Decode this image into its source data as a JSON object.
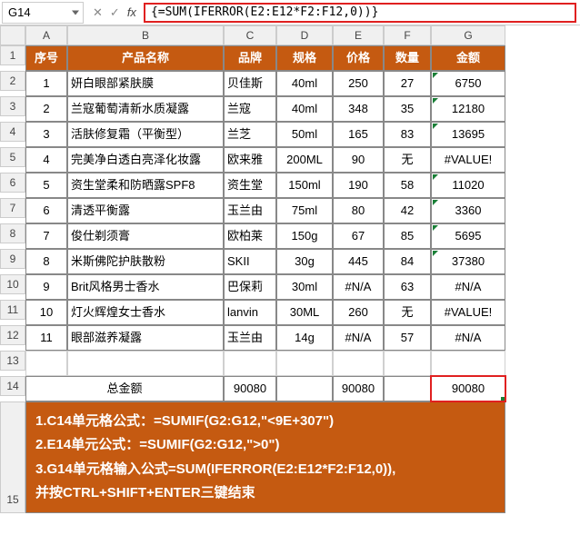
{
  "formula_bar": {
    "cell_ref": "G14",
    "formula": "{=SUM(IFERROR(E2:E12*F2:F12,0))}"
  },
  "columns": [
    "A",
    "B",
    "C",
    "D",
    "E",
    "F",
    "G"
  ],
  "header": {
    "a": "序号",
    "b": "产品名称",
    "c": "品牌",
    "d": "规格",
    "e": "价格",
    "f": "数量",
    "g": "金额"
  },
  "rows": [
    {
      "n": "1",
      "seq": "1",
      "name": "妍白眼部紧肤膜",
      "brand": "贝佳斯",
      "spec": "40ml",
      "price": "250",
      "qty": "27",
      "amt": "6750"
    },
    {
      "n": "2",
      "seq": "2",
      "name": "兰寇葡萄清新水质凝露",
      "brand": "兰寇",
      "spec": "40ml",
      "price": "348",
      "qty": "35",
      "amt": "12180"
    },
    {
      "n": "3",
      "seq": "3",
      "name": "活肤修复霜（平衡型）",
      "brand": "兰芝",
      "spec": "50ml",
      "price": "165",
      "qty": "83",
      "amt": "13695"
    },
    {
      "n": "4",
      "seq": "4",
      "name": "完美净白透白亮泽化妆露",
      "brand": "欧来雅",
      "spec": "200ML",
      "price": "90",
      "qty": "无",
      "amt": "#VALUE!"
    },
    {
      "n": "5",
      "seq": "5",
      "name": "资生堂柔和防晒露SPF8",
      "brand": "资生堂",
      "spec": "150ml",
      "price": "190",
      "qty": "58",
      "amt": "11020"
    },
    {
      "n": "6",
      "seq": "6",
      "name": "清透平衡露",
      "brand": "玉兰由",
      "spec": "75ml",
      "price": "80",
      "qty": "42",
      "amt": "3360"
    },
    {
      "n": "7",
      "seq": "7",
      "name": "俊仕剃须膏",
      "brand": "欧柏莱",
      "spec": "150g",
      "price": "67",
      "qty": "85",
      "amt": "5695"
    },
    {
      "n": "8",
      "seq": "8",
      "name": "米斯佛陀护肤散粉",
      "brand": "SKII",
      "spec": "30g",
      "price": "445",
      "qty": "84",
      "amt": "37380"
    },
    {
      "n": "9",
      "seq": "9",
      "name": "Brit风格男士香水",
      "brand": "巴保莉",
      "spec": "30ml",
      "price": "#N/A",
      "qty": "63",
      "amt": "#N/A"
    },
    {
      "n": "10",
      "seq": "10",
      "name": "灯火辉煌女士香水",
      "brand": "lanvin",
      "spec": "30ML",
      "price": "260",
      "qty": "无",
      "amt": "#VALUE!"
    },
    {
      "n": "11",
      "seq": "11",
      "name": "眼部滋养凝露",
      "brand": "玉兰由",
      "spec": "14g",
      "price": "#N/A",
      "qty": "57",
      "amt": "#N/A"
    }
  ],
  "total": {
    "label": "总金额",
    "c": "90080",
    "e": "90080",
    "g": "90080"
  },
  "notes": {
    "l1": "1.C14单元格公式：=SUMIF(G2:G12,\"<9E+307\")",
    "l2": "2.E14单元公式：=SUMIF(G2:G12,\">0\")",
    "l3": "3.G14单元格输入公式=SUM(IFERROR(E2:E12*F2:F12,0)),",
    "l4": "并按CTRL+SHIFT+ENTER三键结束"
  },
  "chart_data": {
    "type": "table",
    "title": "产品金额汇总",
    "columns": [
      "序号",
      "产品名称",
      "品牌",
      "规格",
      "价格",
      "数量",
      "金额"
    ],
    "records": [
      [
        1,
        "妍白眼部紧肤膜",
        "贝佳斯",
        "40ml",
        250,
        27,
        6750
      ],
      [
        2,
        "兰寇葡萄清新水质凝露",
        "兰寇",
        "40ml",
        348,
        35,
        12180
      ],
      [
        3,
        "活肤修复霜（平衡型）",
        "兰芝",
        "50ml",
        165,
        83,
        13695
      ],
      [
        4,
        "完美净白透白亮泽化妆露",
        "欧来雅",
        "200ML",
        90,
        "无",
        "#VALUE!"
      ],
      [
        5,
        "资生堂柔和防晒露SPF8",
        "资生堂",
        "150ml",
        190,
        58,
        11020
      ],
      [
        6,
        "清透平衡露",
        "玉兰由",
        "75ml",
        80,
        42,
        3360
      ],
      [
        7,
        "俊仕剃须膏",
        "欧柏莱",
        "150g",
        67,
        85,
        5695
      ],
      [
        8,
        "米斯佛陀护肤散粉",
        "SKII",
        "30g",
        445,
        84,
        37380
      ],
      [
        9,
        "Brit风格男士香水",
        "巴保莉",
        "30ml",
        "#N/A",
        63,
        "#N/A"
      ],
      [
        10,
        "灯火辉煌女士香水",
        "lanvin",
        "30ML",
        260,
        "无",
        "#VALUE!"
      ],
      [
        11,
        "眼部滋养凝露",
        "玉兰由",
        "14g",
        "#N/A",
        57,
        "#N/A"
      ]
    ],
    "totals": {
      "C14": 90080,
      "E14": 90080,
      "G14": 90080
    }
  }
}
